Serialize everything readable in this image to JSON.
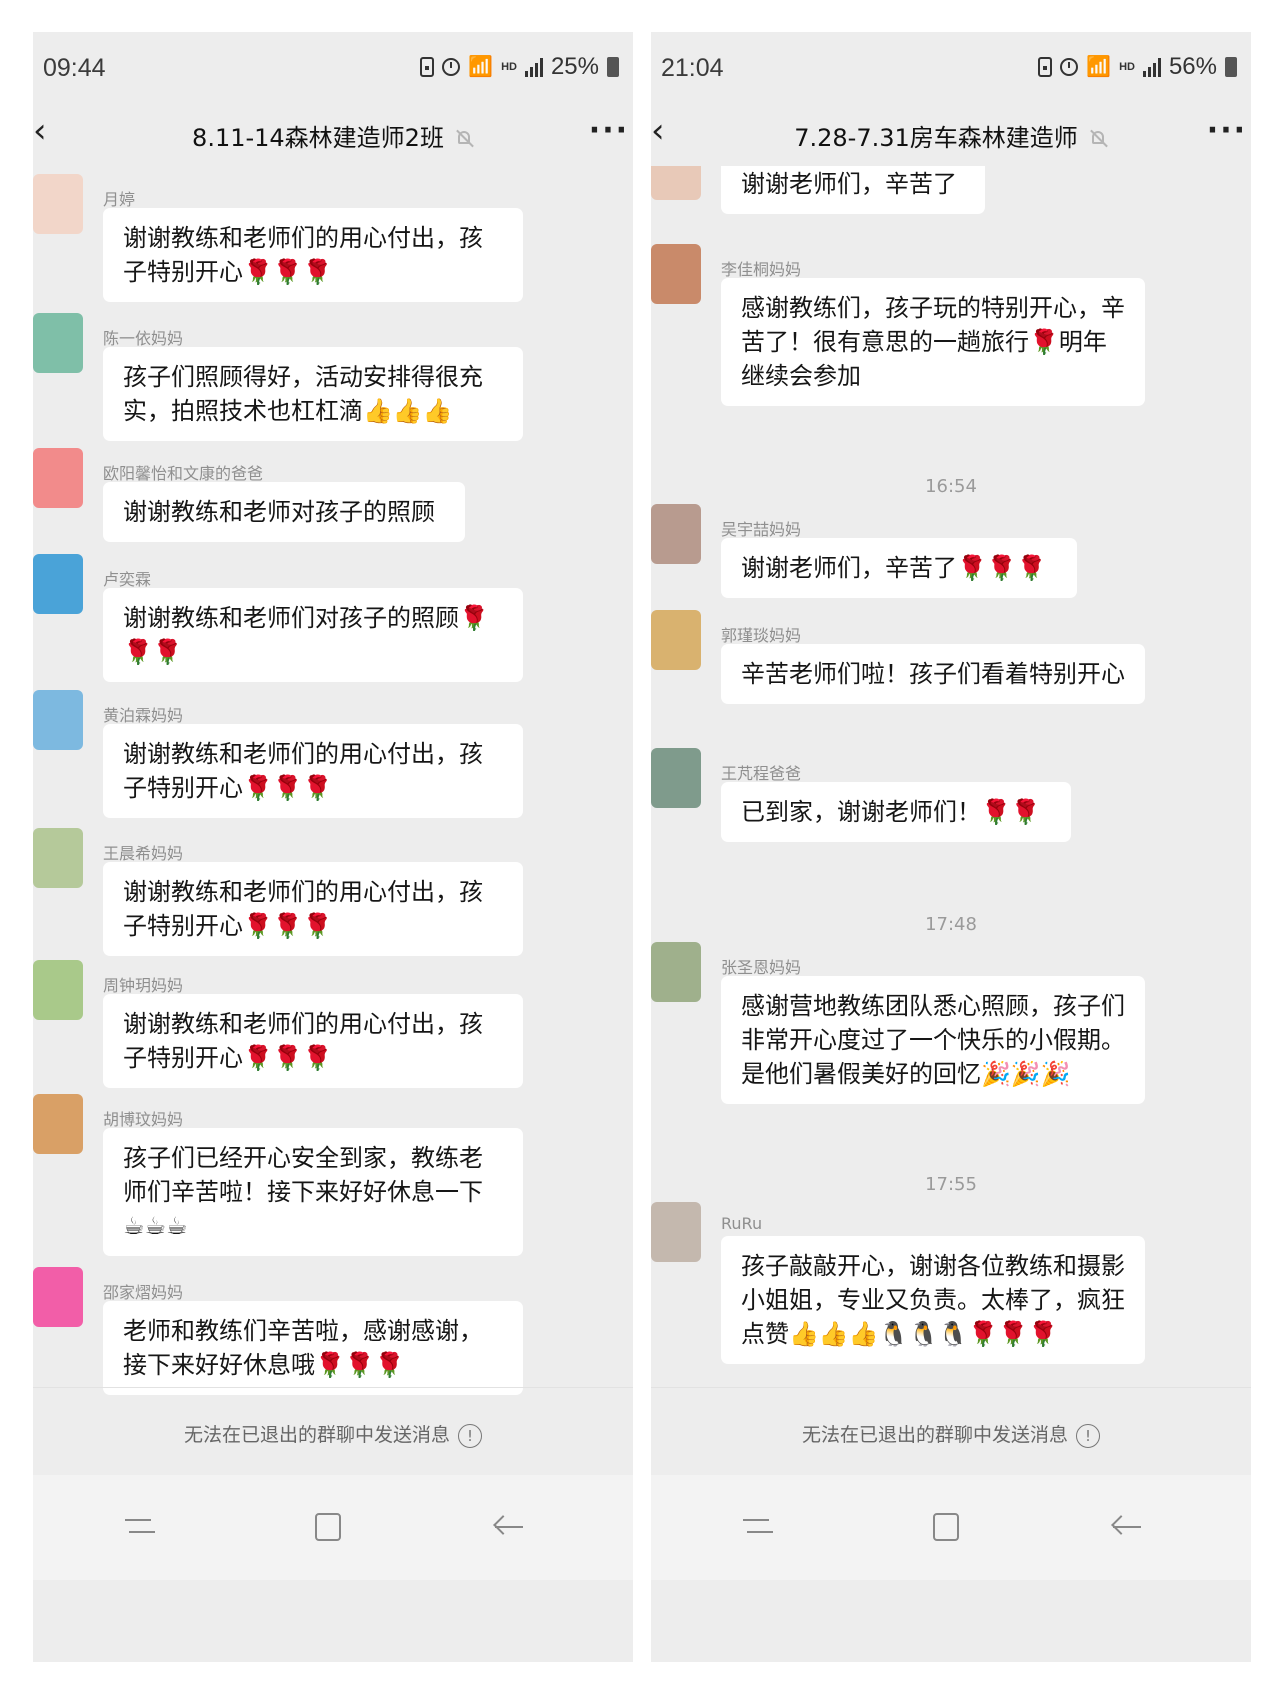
{
  "left": {
    "time": "09:44",
    "battery": "25%",
    "title": "8.11-14森林建造师2班",
    "messages": [
      {
        "sender": "月婷",
        "text": "谢谢教练和老师们的用心付出，孩子特别开心🌹🌹🌹",
        "avatar": "#f2d6c9"
      },
      {
        "sender": "陈一依妈妈",
        "text": "孩子们照顾得好，活动安排得很充实，拍照技术也杠杠滴👍👍👍",
        "avatar": "#7fbfa8"
      },
      {
        "sender": "欧阳馨怡和文康的爸爸",
        "text": "谢谢教练和老师对孩子的照顾",
        "avatar": "#f28b8b"
      },
      {
        "sender": "卢奕霖",
        "text": "谢谢教练和老师们对孩子的照顾🌹🌹🌹",
        "avatar": "#4aa3d8"
      },
      {
        "sender": "黄泊霖妈妈",
        "text": "谢谢教练和老师们的用心付出，孩子特别开心🌹🌹🌹",
        "avatar": "#7db9e0"
      },
      {
        "sender": "王晨希妈妈",
        "text": "谢谢教练和老师们的用心付出，孩子特别开心🌹🌹🌹",
        "avatar": "#b5c99a"
      },
      {
        "sender": "周钟玥妈妈",
        "text": "谢谢教练和老师们的用心付出，孩子特别开心🌹🌹🌹",
        "avatar": "#a9c98a"
      },
      {
        "sender": "胡博玟妈妈",
        "text": "孩子们已经开心安全到家，教练老师们辛苦啦！接下来好好休息一下☕☕☕",
        "avatar": "#d9a066"
      },
      {
        "sender": "邵家熠妈妈",
        "text": "老师和教练们辛苦啦，感谢感谢，接下来好好休息哦🌹🌹🌹",
        "avatar": "#f25ea8"
      }
    ],
    "footer": "无法在已退出的群聊中发送消息"
  },
  "right": {
    "time": "21:04",
    "battery": "56%",
    "title": "7.28-7.31房车森林建造师",
    "items": [
      {
        "kind": "msg",
        "sender": "",
        "text": "谢谢老师们，辛苦了",
        "avatar": "#e8c9b8"
      },
      {
        "kind": "msg",
        "sender": "李佳桐妈妈",
        "text": "感谢教练们，孩子玩的特别开心，辛苦了！很有意思的一趟旅行🌹明年继续会参加",
        "avatar": "#c98a6a"
      },
      {
        "kind": "time",
        "text": "16:54"
      },
      {
        "kind": "msg",
        "sender": "吴宇喆妈妈",
        "text": "谢谢老师们，辛苦了🌹🌹🌹",
        "avatar": "#b89b8f"
      },
      {
        "kind": "msg",
        "sender": "郭瑾琰妈妈",
        "text": "辛苦老师们啦！孩子们看着特别开心",
        "avatar": "#d9b26f"
      },
      {
        "kind": "msg",
        "sender": "王芃程爸爸",
        "text": "已到家，谢谢老师们！🌹🌹",
        "avatar": "#7f9b8c"
      },
      {
        "kind": "time",
        "text": "17:48"
      },
      {
        "kind": "msg",
        "sender": "张圣恩妈妈",
        "text": "感谢营地教练团队悉心照顾，孩子们非常开心度过了一个快乐的小假期。是他们暑假美好的回忆🎉🎉🎉",
        "avatar": "#9fb08c"
      },
      {
        "kind": "time",
        "text": "17:55"
      },
      {
        "kind": "msg",
        "sender": "RuRu",
        "text": "孩子敲敲开心，谢谢各位教练和摄影小姐姐，专业又负责。太棒了，疯狂点赞👍👍👍🐧🐧🐧🌹🌹🌹",
        "avatar": "#c4b8ae"
      }
    ],
    "footer": "无法在已退出的群聊中发送消息"
  }
}
